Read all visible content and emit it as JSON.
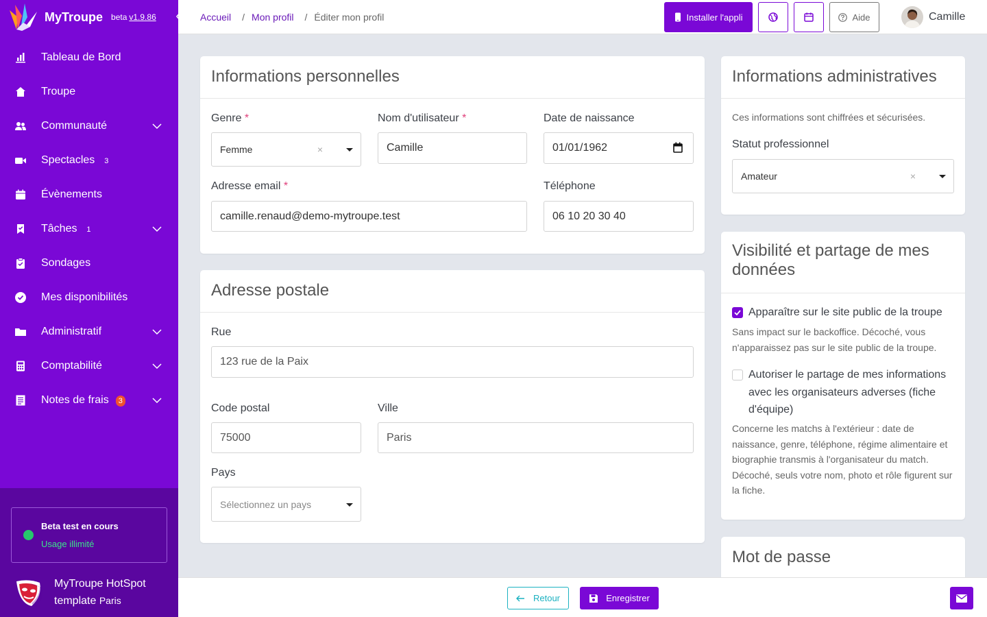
{
  "brand": {
    "name": "MyTroupe",
    "beta": "beta",
    "version": "v1.9.86"
  },
  "sidebar": {
    "items": [
      {
        "label": "Tableau de Bord",
        "icon": "chart-bar-icon"
      },
      {
        "label": "Troupe",
        "icon": "home-icon"
      },
      {
        "label": "Communauté",
        "icon": "users-icon",
        "expandable": true
      },
      {
        "label": "Spectacles",
        "icon": "video-icon",
        "badge": "3"
      },
      {
        "label": "Évènements",
        "icon": "calendar-icon"
      },
      {
        "label": "Tâches",
        "icon": "bookmark-check-icon",
        "badge": "1",
        "expandable": true
      },
      {
        "label": "Sondages",
        "icon": "clipboard-check-icon"
      },
      {
        "label": "Mes disponibilités",
        "icon": "check-circle-icon"
      },
      {
        "label": "Administratif",
        "icon": "folder-icon",
        "expandable": true
      },
      {
        "label": "Comptabilité",
        "icon": "calculator-icon",
        "expandable": true
      },
      {
        "label": "Notes de frais",
        "icon": "receipt-icon",
        "badge": "3",
        "expandable": true
      }
    ],
    "beta_card": {
      "title": "Beta test en cours",
      "subtitle": "Usage illimité"
    },
    "org": {
      "name": "MyTroupe HotSpot template",
      "city": "Paris"
    }
  },
  "breadcrumb": {
    "home": "Accueil",
    "profile": "Mon profil",
    "separator": "/",
    "current": "Éditer mon profil"
  },
  "header": {
    "install_label": "Installer l'appli",
    "help_label": "Aide",
    "user_name": "Camille"
  },
  "personal": {
    "title": "Informations personnelles",
    "gender_label": "Genre",
    "gender_value": "Femme",
    "username_label": "Nom d'utilisateur",
    "username_value": "Camille",
    "birth_label": "Date de naissance",
    "birth_value": "01/01/1962",
    "email_label": "Adresse email",
    "email_value": "camille.renaud@demo-mytroupe.test",
    "phone_label": "Téléphone",
    "phone_value": "06 10 20 30 40",
    "required_mark": "*",
    "clear_mark": "×"
  },
  "address": {
    "title": "Adresse postale",
    "street_label": "Rue",
    "street_value": "123 rue de la Paix",
    "zip_label": "Code postal",
    "zip_value": "75000",
    "city_label": "Ville",
    "city_value": "Paris",
    "country_label": "Pays",
    "country_placeholder": "Sélectionnez un pays"
  },
  "admin": {
    "title": "Informations administratives",
    "note": "Ces informations sont chiffrées et sécurisées.",
    "status_label": "Statut professionnel",
    "status_value": "Amateur"
  },
  "visibility": {
    "title": "Visibilité et partage de mes données",
    "public_label": "Apparaître sur le site public de la troupe",
    "public_checked": true,
    "public_help": "Sans impact sur le backoffice. Décoché, vous n'apparaissez pas sur le site public de la troupe.",
    "share_label": "Autoriser le partage de mes informations avec les organisateurs adverses (fiche d'équipe)",
    "share_checked": false,
    "share_help": "Concerne les matchs à l'extérieur : date de naissance, genre, téléphone, régime alimentaire et biographie transmis à l'organisateur du match. Décoché, seuls votre nom, photo et rôle figurent sur la fiche."
  },
  "password": {
    "title": "Mot de passe"
  },
  "footer": {
    "back_label": "Retour",
    "save_label": "Enregistrer"
  },
  "colors": {
    "primary": "#7a08d6",
    "sidebar_bottom": "#5a069f",
    "accent_teal": "#1bb2c1",
    "badge_red": "#f0522f",
    "status_green": "#26c86c"
  }
}
